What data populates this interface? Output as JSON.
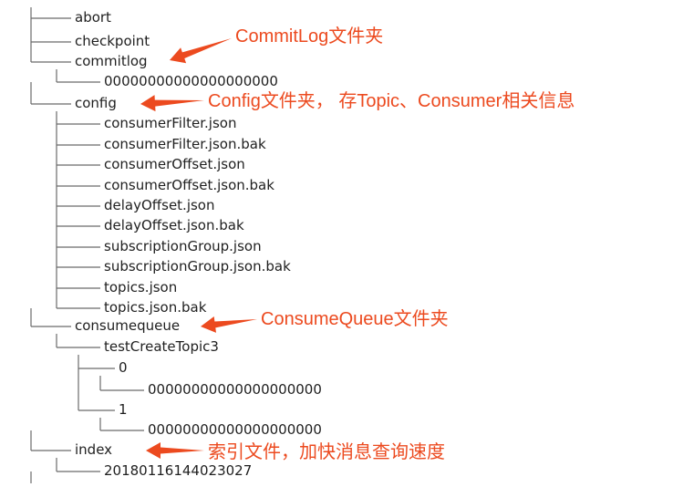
{
  "tree": [
    {
      "id": "abort",
      "label": "abort",
      "depth": 0
    },
    {
      "id": "checkpoint",
      "label": "checkpoint",
      "depth": 0
    },
    {
      "id": "commitlog",
      "label": "commitlog",
      "depth": 0
    },
    {
      "id": "commitlog-file",
      "label": "00000000000000000000",
      "depth": 1
    },
    {
      "id": "config",
      "label": "config",
      "depth": 0
    },
    {
      "id": "consumerFilter",
      "label": "consumerFilter.json",
      "depth": 1
    },
    {
      "id": "consumerFilter-bak",
      "label": "consumerFilter.json.bak",
      "depth": 1
    },
    {
      "id": "consumerOffset",
      "label": "consumerOffset.json",
      "depth": 1
    },
    {
      "id": "consumerOffset-bak",
      "label": "consumerOffset.json.bak",
      "depth": 1
    },
    {
      "id": "delayOffset",
      "label": "delayOffset.json",
      "depth": 1
    },
    {
      "id": "delayOffset-bak",
      "label": "delayOffset.json.bak",
      "depth": 1
    },
    {
      "id": "subscriptionGroup",
      "label": "subscriptionGroup.json",
      "depth": 1
    },
    {
      "id": "subscriptionGroup-bak",
      "label": "subscriptionGroup.json.bak",
      "depth": 1
    },
    {
      "id": "topics",
      "label": "topics.json",
      "depth": 1
    },
    {
      "id": "topics-bak",
      "label": "topics.json.bak",
      "depth": 1
    },
    {
      "id": "consumequeue",
      "label": "consumequeue",
      "depth": 0
    },
    {
      "id": "testCreateTopic3",
      "label": "testCreateTopic3",
      "depth": 1
    },
    {
      "id": "queue-0",
      "label": "0",
      "depth": 2
    },
    {
      "id": "queue-0-file",
      "label": "00000000000000000000",
      "depth": 3
    },
    {
      "id": "queue-1",
      "label": "1",
      "depth": 2
    },
    {
      "id": "queue-1-file",
      "label": "00000000000000000000",
      "depth": 3
    },
    {
      "id": "index",
      "label": "index",
      "depth": 0
    },
    {
      "id": "index-file",
      "label": "20180116144023027",
      "depth": 1
    }
  ],
  "annotations": [
    {
      "id": "commitlog-note",
      "target": "commitlog",
      "text": "CommitLog文件夹"
    },
    {
      "id": "config-note",
      "target": "config",
      "text": "Config文件夹， 存Topic、Consumer相关信息"
    },
    {
      "id": "consumequeue-note",
      "target": "consumequeue",
      "text": "ConsumeQueue文件夹"
    },
    {
      "id": "index-note",
      "target": "index",
      "text": "索引文件，加快消息查询速度"
    }
  ],
  "colors": {
    "annotation": "#ec4a1f",
    "tree_text": "#1f1f1f",
    "tree_lines": "#6a6a6a"
  }
}
